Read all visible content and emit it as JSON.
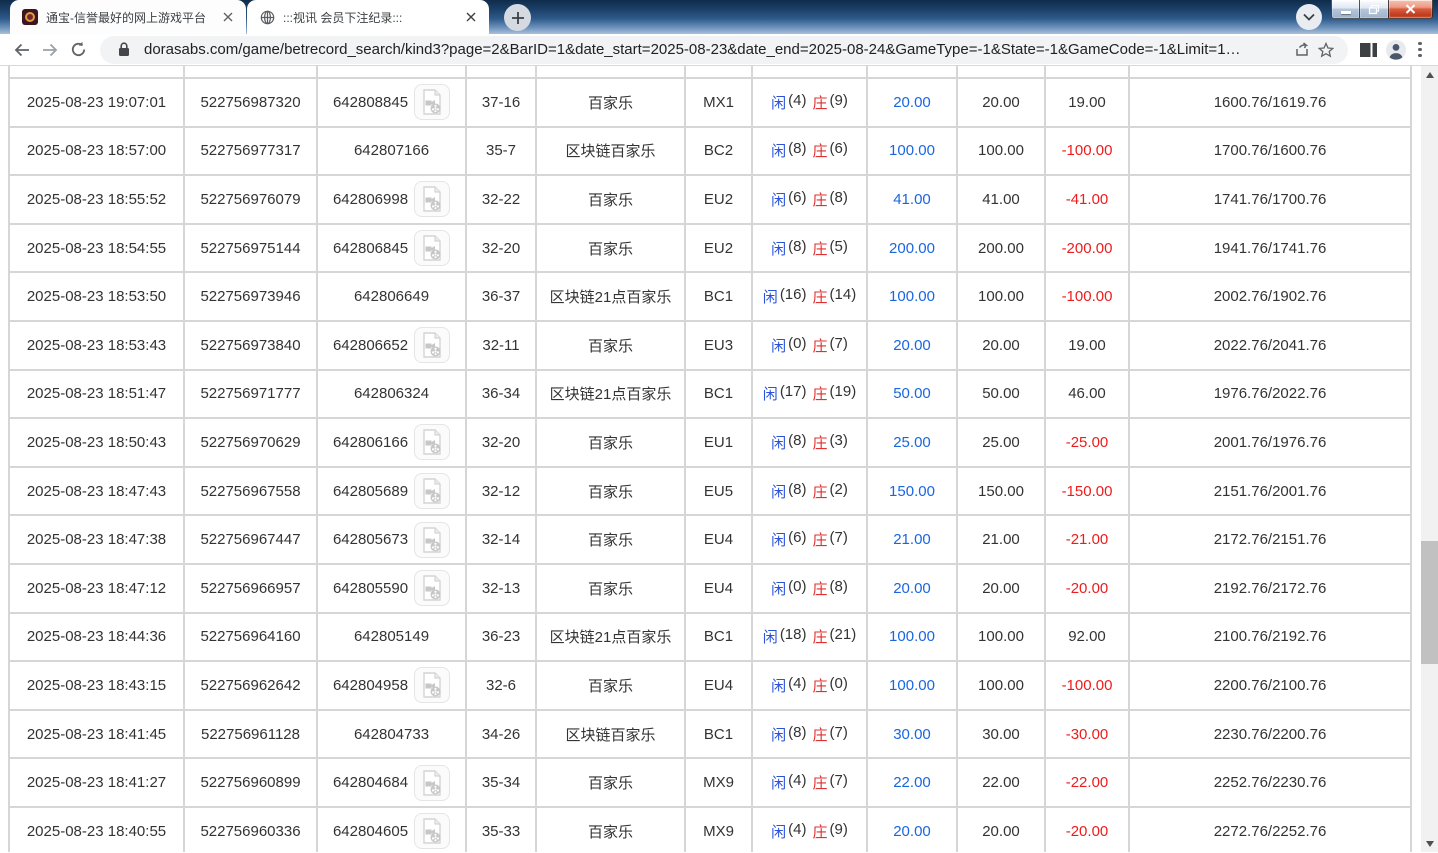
{
  "browser": {
    "tabs": [
      {
        "title": "通宝-信誉最好的网上游戏平台"
      },
      {
        "title": ":::视讯 会员下注纪录:::"
      }
    ],
    "url": "dorasabs.com/game/betrecord_search/kind3?page=2&BarID=1&date_start=2025-08-23&date_end=2025-08-24&GameType=-1&State=-1&GameCode=-1&Limit=1…"
  },
  "colors": {
    "bet_amount_blue": "#1a66e0",
    "loss_red": "#ee1c1c",
    "player_blue": "#2a52d8",
    "banker_red": "#e03030",
    "row_border": "#d6d6d6",
    "text": "#333333"
  },
  "table": {
    "rows": [
      {
        "time": "2025-08-23 19:07:01",
        "bet_id": "522756987320",
        "round_no": "642808845",
        "has_video": true,
        "result": "37-16",
        "game": "百家乐",
        "table_code": "MX1",
        "player": "闲",
        "player_score": "(4)",
        "banker": "庄",
        "banker_score": "(9)",
        "bet_amount": "20.00",
        "valid_amount": "20.00",
        "win_loss": "19.00",
        "balance": "1600.76/1619.76"
      },
      {
        "time": "2025-08-23 18:57:00",
        "bet_id": "522756977317",
        "round_no": "642807166",
        "has_video": false,
        "result": "35-7",
        "game": "区块链百家乐",
        "table_code": "BC2",
        "player": "闲",
        "player_score": "(8)",
        "banker": "庄",
        "banker_score": "(6)",
        "bet_amount": "100.00",
        "valid_amount": "100.00",
        "win_loss": "-100.00",
        "balance": "1700.76/1600.76"
      },
      {
        "time": "2025-08-23 18:55:52",
        "bet_id": "522756976079",
        "round_no": "642806998",
        "has_video": true,
        "result": "32-22",
        "game": "百家乐",
        "table_code": "EU2",
        "player": "闲",
        "player_score": "(6)",
        "banker": "庄",
        "banker_score": "(8)",
        "bet_amount": "41.00",
        "valid_amount": "41.00",
        "win_loss": "-41.00",
        "balance": "1741.76/1700.76"
      },
      {
        "time": "2025-08-23 18:54:55",
        "bet_id": "522756975144",
        "round_no": "642806845",
        "has_video": true,
        "result": "32-20",
        "game": "百家乐",
        "table_code": "EU2",
        "player": "闲",
        "player_score": "(8)",
        "banker": "庄",
        "banker_score": "(5)",
        "bet_amount": "200.00",
        "valid_amount": "200.00",
        "win_loss": "-200.00",
        "balance": "1941.76/1741.76"
      },
      {
        "time": "2025-08-23 18:53:50",
        "bet_id": "522756973946",
        "round_no": "642806649",
        "has_video": false,
        "result": "36-37",
        "game": "区块链21点百家乐",
        "table_code": "BC1",
        "player": "闲",
        "player_score": "(16)",
        "banker": "庄",
        "banker_score": "(14)",
        "bet_amount": "100.00",
        "valid_amount": "100.00",
        "win_loss": "-100.00",
        "balance": "2002.76/1902.76"
      },
      {
        "time": "2025-08-23 18:53:43",
        "bet_id": "522756973840",
        "round_no": "642806652",
        "has_video": true,
        "result": "32-11",
        "game": "百家乐",
        "table_code": "EU3",
        "player": "闲",
        "player_score": "(0)",
        "banker": "庄",
        "banker_score": "(7)",
        "bet_amount": "20.00",
        "valid_amount": "20.00",
        "win_loss": "19.00",
        "balance": "2022.76/2041.76"
      },
      {
        "time": "2025-08-23 18:51:47",
        "bet_id": "522756971777",
        "round_no": "642806324",
        "has_video": false,
        "result": "36-34",
        "game": "区块链21点百家乐",
        "table_code": "BC1",
        "player": "闲",
        "player_score": "(17)",
        "banker": "庄",
        "banker_score": "(19)",
        "bet_amount": "50.00",
        "valid_amount": "50.00",
        "win_loss": "46.00",
        "balance": "1976.76/2022.76"
      },
      {
        "time": "2025-08-23 18:50:43",
        "bet_id": "522756970629",
        "round_no": "642806166",
        "has_video": true,
        "result": "32-20",
        "game": "百家乐",
        "table_code": "EU1",
        "player": "闲",
        "player_score": "(8)",
        "banker": "庄",
        "banker_score": "(3)",
        "bet_amount": "25.00",
        "valid_amount": "25.00",
        "win_loss": "-25.00",
        "balance": "2001.76/1976.76"
      },
      {
        "time": "2025-08-23 18:47:43",
        "bet_id": "522756967558",
        "round_no": "642805689",
        "has_video": true,
        "result": "32-12",
        "game": "百家乐",
        "table_code": "EU5",
        "player": "闲",
        "player_score": "(8)",
        "banker": "庄",
        "banker_score": "(2)",
        "bet_amount": "150.00",
        "valid_amount": "150.00",
        "win_loss": "-150.00",
        "balance": "2151.76/2001.76"
      },
      {
        "time": "2025-08-23 18:47:38",
        "bet_id": "522756967447",
        "round_no": "642805673",
        "has_video": true,
        "result": "32-14",
        "game": "百家乐",
        "table_code": "EU4",
        "player": "闲",
        "player_score": "(6)",
        "banker": "庄",
        "banker_score": "(7)",
        "bet_amount": "21.00",
        "valid_amount": "21.00",
        "win_loss": "-21.00",
        "balance": "2172.76/2151.76"
      },
      {
        "time": "2025-08-23 18:47:12",
        "bet_id": "522756966957",
        "round_no": "642805590",
        "has_video": true,
        "result": "32-13",
        "game": "百家乐",
        "table_code": "EU4",
        "player": "闲",
        "player_score": "(0)",
        "banker": "庄",
        "banker_score": "(8)",
        "bet_amount": "20.00",
        "valid_amount": "20.00",
        "win_loss": "-20.00",
        "balance": "2192.76/2172.76"
      },
      {
        "time": "2025-08-23 18:44:36",
        "bet_id": "522756964160",
        "round_no": "642805149",
        "has_video": false,
        "result": "36-23",
        "game": "区块链21点百家乐",
        "table_code": "BC1",
        "player": "闲",
        "player_score": "(18)",
        "banker": "庄",
        "banker_score": "(21)",
        "bet_amount": "100.00",
        "valid_amount": "100.00",
        "win_loss": "92.00",
        "balance": "2100.76/2192.76"
      },
      {
        "time": "2025-08-23 18:43:15",
        "bet_id": "522756962642",
        "round_no": "642804958",
        "has_video": true,
        "result": "32-6",
        "game": "百家乐",
        "table_code": "EU4",
        "player": "闲",
        "player_score": "(4)",
        "banker": "庄",
        "banker_score": "(0)",
        "bet_amount": "100.00",
        "valid_amount": "100.00",
        "win_loss": "-100.00",
        "balance": "2200.76/2100.76"
      },
      {
        "time": "2025-08-23 18:41:45",
        "bet_id": "522756961128",
        "round_no": "642804733",
        "has_video": false,
        "result": "34-26",
        "game": "区块链百家乐",
        "table_code": "BC1",
        "player": "闲",
        "player_score": "(8)",
        "banker": "庄",
        "banker_score": "(7)",
        "bet_amount": "30.00",
        "valid_amount": "30.00",
        "win_loss": "-30.00",
        "balance": "2230.76/2200.76"
      },
      {
        "time": "2025-08-23 18:41:27",
        "bet_id": "522756960899",
        "round_no": "642804684",
        "has_video": true,
        "result": "35-34",
        "game": "百家乐",
        "table_code": "MX9",
        "player": "闲",
        "player_score": "(4)",
        "banker": "庄",
        "banker_score": "(7)",
        "bet_amount": "22.00",
        "valid_amount": "22.00",
        "win_loss": "-22.00",
        "balance": "2252.76/2230.76"
      },
      {
        "time": "2025-08-23 18:40:55",
        "bet_id": "522756960336",
        "round_no": "642804605",
        "has_video": true,
        "result": "35-33",
        "game": "百家乐",
        "table_code": "MX9",
        "player": "闲",
        "player_score": "(4)",
        "banker": "庄",
        "banker_score": "(9)",
        "bet_amount": "20.00",
        "valid_amount": "20.00",
        "win_loss": "-20.00",
        "balance": "2272.76/2252.76"
      }
    ]
  }
}
